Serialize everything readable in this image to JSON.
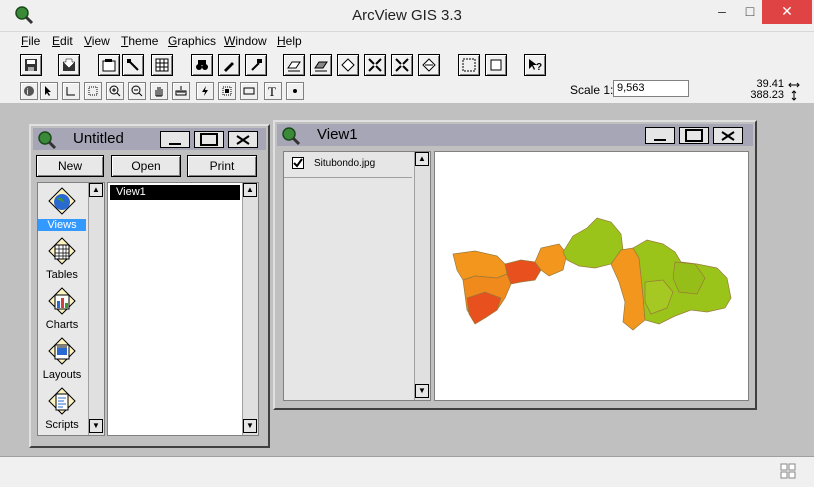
{
  "app": {
    "title": "ArcView GIS 3.3"
  },
  "window_controls": {
    "minimize": "–",
    "maximize": "□",
    "close": "✕"
  },
  "menu": [
    {
      "label": "File",
      "key": "F",
      "rest": "ile"
    },
    {
      "label": "Edit",
      "key": "E",
      "rest": "dit"
    },
    {
      "label": "View",
      "key": "V",
      "rest": "iew"
    },
    {
      "label": "Theme",
      "key": "T",
      "rest": "heme"
    },
    {
      "label": "Graphics",
      "key": "G",
      "rest": "raphics"
    },
    {
      "label": "Window",
      "key": "W",
      "rest": "indow"
    },
    {
      "label": "Help",
      "key": "H",
      "rest": "elp"
    }
  ],
  "toolbar": {
    "scale_label": "Scale 1:",
    "scale_value": "9,563",
    "coord_x": "39.41",
    "coord_y": "388.23"
  },
  "project_window": {
    "title": "Untitled",
    "buttons": {
      "new": "New",
      "open": "Open",
      "print": "Print"
    },
    "doc_types": [
      {
        "label": "Views",
        "icon": "globe-icon",
        "selected": true
      },
      {
        "label": "Tables",
        "icon": "table-icon",
        "selected": false
      },
      {
        "label": "Charts",
        "icon": "chart-icon",
        "selected": false
      },
      {
        "label": "Layouts",
        "icon": "layout-icon",
        "selected": false
      },
      {
        "label": "Scripts",
        "icon": "script-icon",
        "selected": false
      }
    ],
    "items": [
      "View1"
    ]
  },
  "view_window": {
    "title": "View1",
    "themes": [
      {
        "name": "Situbondo.jpg",
        "checked": true
      }
    ]
  },
  "colors": {
    "map_green": "#9bc41a",
    "map_orange": "#f2961e",
    "map_red": "#e8501e",
    "selection": "#0a246a",
    "views_highlight": "#3399ff"
  }
}
